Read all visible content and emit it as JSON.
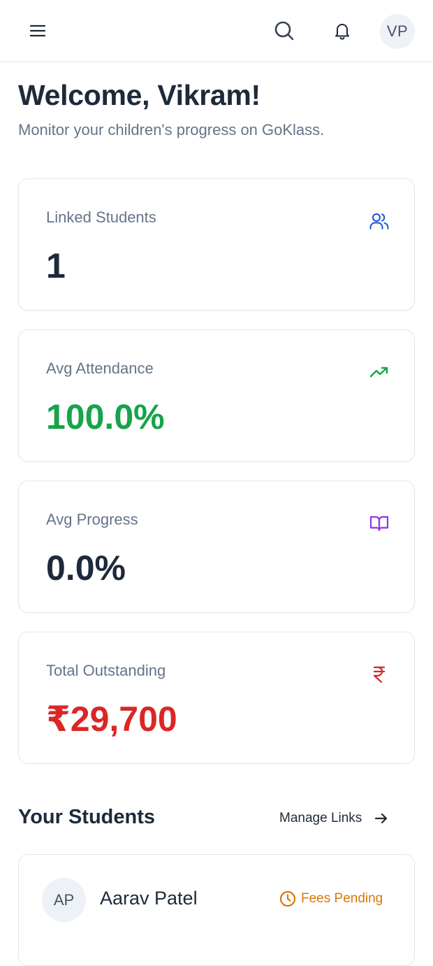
{
  "header": {
    "avatar_initials": "VP"
  },
  "welcome": {
    "title": "Welcome, Vikram!",
    "subtitle": "Monitor your children's progress on GoKlass."
  },
  "stats": [
    {
      "label": "Linked Students",
      "value": "1",
      "icon": "users-icon",
      "color": "#1e293b",
      "icon_color": "#1d4ed8"
    },
    {
      "label": "Avg Attendance",
      "value": "100.0%",
      "icon": "trending-up-icon",
      "color": "#16a34a",
      "icon_color": "#16a34a"
    },
    {
      "label": "Avg Progress",
      "value": "0.0%",
      "icon": "book-open-icon",
      "color": "#1e293b",
      "icon_color": "#9333ea"
    },
    {
      "label": "Total Outstanding",
      "value": "₹29,700",
      "icon": "rupee-icon",
      "color": "#dc2626",
      "icon_color": "#dc2626"
    }
  ],
  "students_section": {
    "title": "Your Students",
    "manage_label": "Manage Links",
    "students": [
      {
        "initials": "AP",
        "name": "Aarav Patel",
        "status": "Fees Pending",
        "status_color": "#d97706"
      }
    ]
  }
}
